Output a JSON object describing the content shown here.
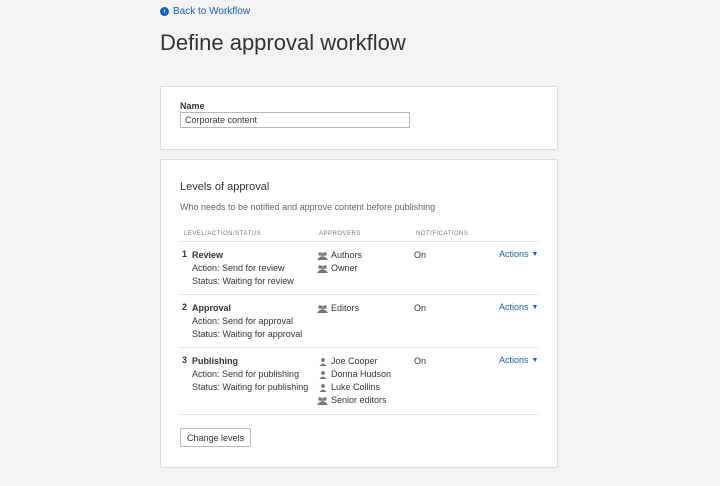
{
  "nav": {
    "back_label": "Back to Workflow"
  },
  "page": {
    "title": "Define approval workflow"
  },
  "name_card": {
    "label": "Name",
    "value": "Corporate content"
  },
  "levels_card": {
    "title": "Levels of approval",
    "description": "Who needs to be notified and approve content before publishing",
    "columns": {
      "level": "LEVEL/ACTION/STATUS",
      "approvers": "APPROVERS",
      "notifications": "NOTIFICATIONS"
    },
    "rows": [
      {
        "number": "1",
        "name": "Review",
        "action": "Action: Send for review",
        "status": "Status: Waiting for review",
        "approvers": [
          {
            "icon": "group-icon",
            "label": "Authors"
          },
          {
            "icon": "group-icon",
            "label": "Owner"
          }
        ],
        "notifications": "On",
        "actions_label": "Actions"
      },
      {
        "number": "2",
        "name": "Approval",
        "action": "Action: Send for approval",
        "status": "Status: Waiting for approval",
        "approvers": [
          {
            "icon": "group-icon",
            "label": "Editors"
          }
        ],
        "notifications": "On",
        "actions_label": "Actions"
      },
      {
        "number": "3",
        "name": "Publishing",
        "action": "Action: Send for publishing",
        "status": "Status: Waiting for publishing",
        "approvers": [
          {
            "icon": "person-icon",
            "label": "Joe Cooper"
          },
          {
            "icon": "person-icon",
            "label": "Donna Hudson"
          },
          {
            "icon": "person-icon",
            "label": "Luke Collins"
          },
          {
            "icon": "group-icon",
            "label": "Senior editors"
          }
        ],
        "notifications": "On",
        "actions_label": "Actions"
      }
    ],
    "change_levels_label": "Change levels"
  },
  "colors": {
    "link": "#1a5fb4",
    "background": "#f3f3f3",
    "card": "#ffffff"
  }
}
